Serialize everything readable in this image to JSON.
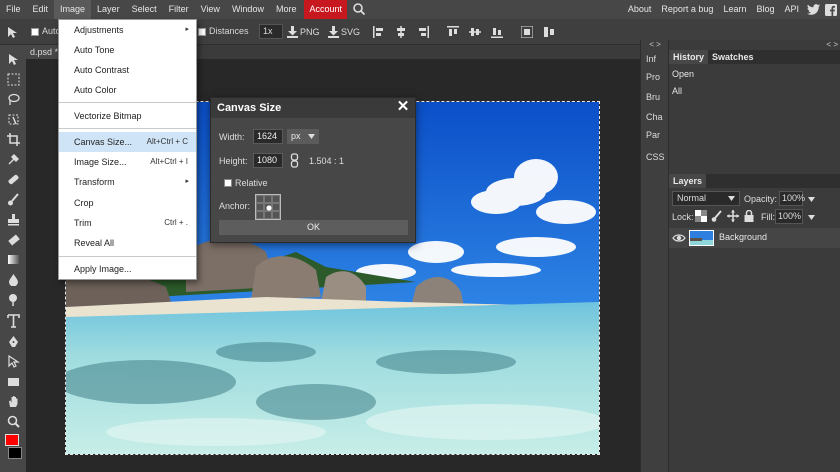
{
  "menubar": {
    "items": [
      "File",
      "Edit",
      "Image",
      "Layer",
      "Select",
      "Filter",
      "View",
      "Window",
      "More"
    ],
    "account": "Account",
    "right_links": [
      "About",
      "Report a bug",
      "Learn",
      "Blog",
      "API"
    ],
    "account_color": "#c8181f"
  },
  "options": {
    "auto_select": "Auto",
    "distances": "Distances",
    "scale": "1x",
    "png": "PNG",
    "svg": "SVG"
  },
  "document": {
    "tab": "d.psd *"
  },
  "image_menu": {
    "items": [
      {
        "label": "Adjustments",
        "shortcut": "",
        "submenu": true
      },
      {
        "label": "Auto Tone",
        "shortcut": "",
        "submenu": false
      },
      {
        "label": "Auto Contrast",
        "shortcut": "",
        "submenu": false
      },
      {
        "label": "Auto Color",
        "shortcut": "",
        "submenu": false
      },
      {
        "label": "Vectorize Bitmap",
        "shortcut": "",
        "submenu": false
      },
      {
        "label": "Canvas Size...",
        "shortcut": "Alt+Ctrl + C",
        "submenu": false
      },
      {
        "label": "Image Size...",
        "shortcut": "Alt+Ctrl + I",
        "submenu": false
      },
      {
        "label": "Transform",
        "shortcut": "",
        "submenu": true
      },
      {
        "label": "Crop",
        "shortcut": "",
        "submenu": false
      },
      {
        "label": "Trim",
        "shortcut": "Ctrl + .",
        "submenu": false
      },
      {
        "label": "Reveal All",
        "shortcut": "",
        "submenu": false
      },
      {
        "label": "Apply Image...",
        "shortcut": "",
        "submenu": false
      }
    ],
    "submenu_arrow": "▸"
  },
  "dialog": {
    "title": "Canvas Size",
    "close": "✕",
    "width_label": "Width:",
    "width_value": "1624",
    "unit": "px",
    "height_label": "Height:",
    "height_value": "1080",
    "ratio": "1.504 : 1",
    "relative_label": "Relative",
    "anchor_label": "Anchor:",
    "ok": "OK"
  },
  "side_tabs": [
    "Inf",
    "Pro",
    "Bru",
    "Cha",
    "Par",
    "CSS"
  ],
  "collapse_glyph": "< >",
  "history": {
    "tabs": [
      "History",
      "Swatches"
    ],
    "items": [
      "Open",
      "All"
    ]
  },
  "layers": {
    "tab": "Layers",
    "blend_mode": "Normal",
    "opacity_label": "Opacity:",
    "opacity_value": "100%",
    "lock_label": "Lock:",
    "fill_label": "Fill:",
    "fill_value": "100%",
    "layer_name": "Background"
  },
  "colors": {
    "foreground": "#ff0000",
    "background": "#000000"
  }
}
